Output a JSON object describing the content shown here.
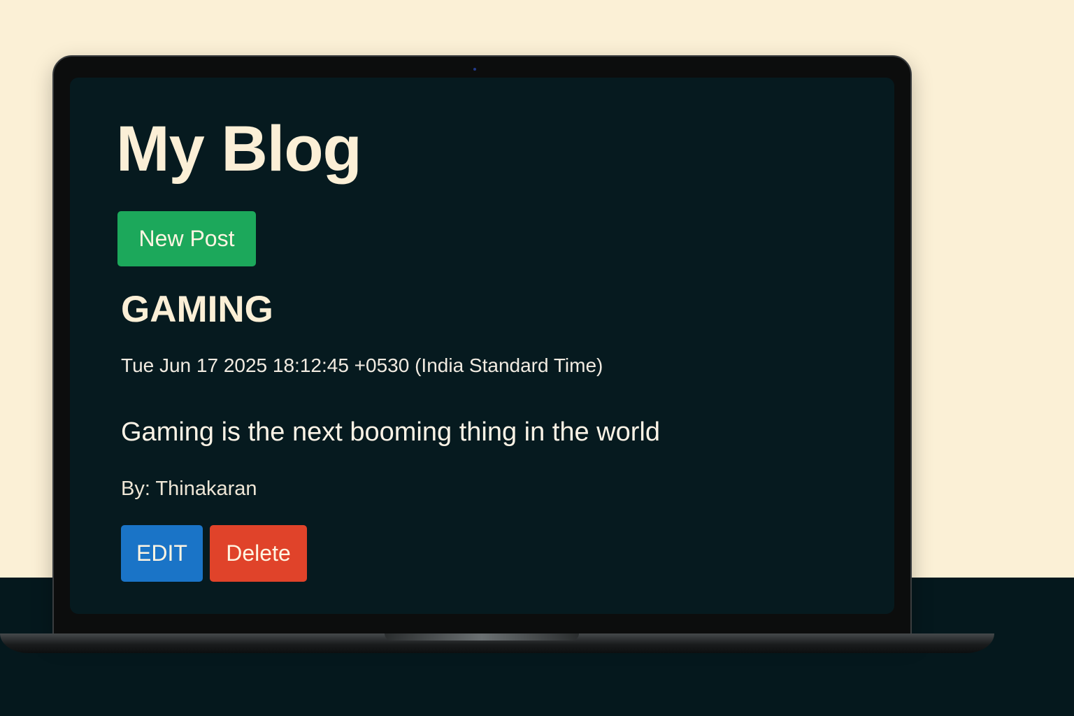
{
  "blog": {
    "title": "My Blog",
    "new_post_label": "New Post"
  },
  "post": {
    "title": "GAMING",
    "date": "Tue Jun 17 2025 18:12:45 +0530 (India Standard Time)",
    "content": "Gaming is the next booming thing in the world",
    "author": "By: Thinakaran",
    "edit_label": "EDIT",
    "delete_label": "Delete"
  },
  "colors": {
    "background": "#fbf0d6",
    "screen": "#061a1f",
    "text": "#fbefd6",
    "new_post_button": "#1ca85b",
    "edit_button": "#1a74c7",
    "delete_button": "#e0432a"
  }
}
